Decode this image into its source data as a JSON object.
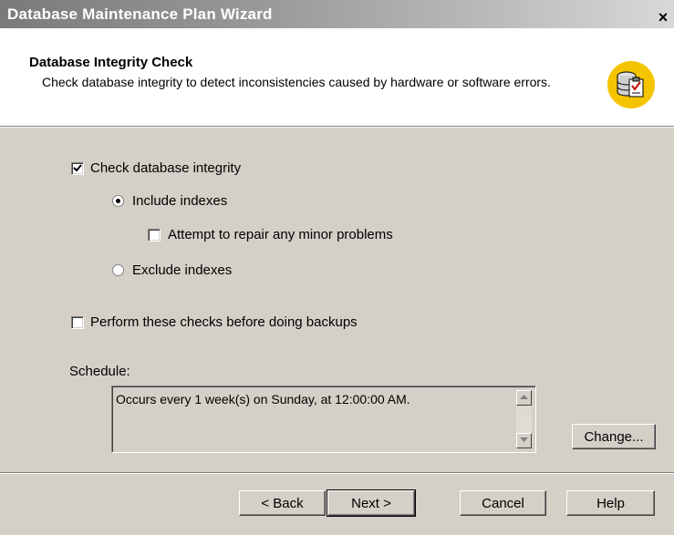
{
  "window": {
    "title": "Database Maintenance Plan Wizard",
    "close_symbol": "×"
  },
  "header": {
    "title": "Database Integrity Check",
    "description": "Check database integrity to detect inconsistencies caused by hardware or software errors.",
    "icon": "database-check-icon"
  },
  "options": {
    "check_integrity": {
      "label": "Check database integrity",
      "checked": true
    },
    "include_indexes": {
      "label": "Include indexes",
      "selected": true
    },
    "attempt_repair": {
      "label": "Attempt to repair any minor problems",
      "checked": false
    },
    "exclude_indexes": {
      "label": "Exclude indexes",
      "selected": false
    },
    "before_backups": {
      "label": "Perform these checks before doing backups",
      "checked": false
    }
  },
  "schedule": {
    "label": "Schedule:",
    "text": "Occurs every 1 week(s) on Sunday, at 12:00:00 AM.",
    "change_label": "Change..."
  },
  "footer": {
    "back_label": "< Back",
    "next_label": "Next >",
    "cancel_label": "Cancel",
    "help_label": "Help"
  },
  "colors": {
    "dialog_bg": "#d4d0c8",
    "header_bg": "#ffffff",
    "icon_circle": "#f5c400"
  }
}
